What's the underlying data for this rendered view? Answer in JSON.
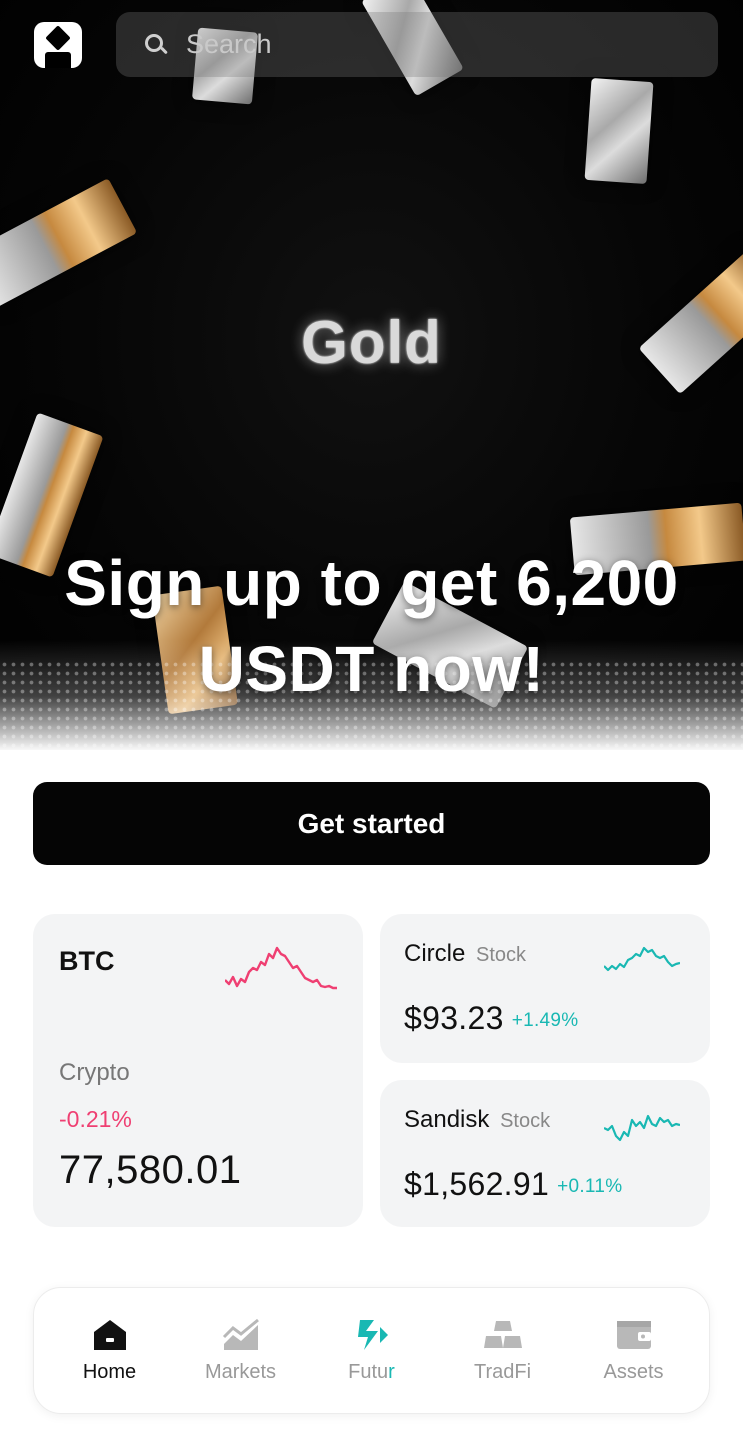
{
  "topbar": {
    "search_placeholder": "Search"
  },
  "hero": {
    "brand_word": "Gold",
    "headline": "Sign up to get 6,200 USDT now!"
  },
  "cta": {
    "label": "Get started"
  },
  "cards": {
    "btc": {
      "symbol": "BTC",
      "category": "Crypto",
      "change": "-0.21%",
      "price": "77,580.01",
      "trend_color": "#ef3f72"
    },
    "circle": {
      "name": "Circle",
      "tag": "Stock",
      "price": "$93.23",
      "change": "+1.49%",
      "trend_color": "#19b8b3"
    },
    "sandisk": {
      "name": "Sandisk",
      "tag": "Stock",
      "price": "$1,562.91",
      "change": "+0.11%",
      "trend_color": "#19b8b3"
    }
  },
  "nav": {
    "items": [
      {
        "label": "Home",
        "icon": "home-icon",
        "active": true
      },
      {
        "label": "Markets",
        "icon": "markets-icon"
      },
      {
        "label_main": "Futu",
        "label_accent": "r",
        "icon": "futures-icon"
      },
      {
        "label": "TradFi",
        "icon": "gold-bars-icon"
      },
      {
        "label": "Assets",
        "icon": "wallet-icon"
      }
    ]
  },
  "colors": {
    "accent_teal": "#19b8b3",
    "negative_pink": "#ef3f72",
    "cta_bg": "#050505"
  }
}
